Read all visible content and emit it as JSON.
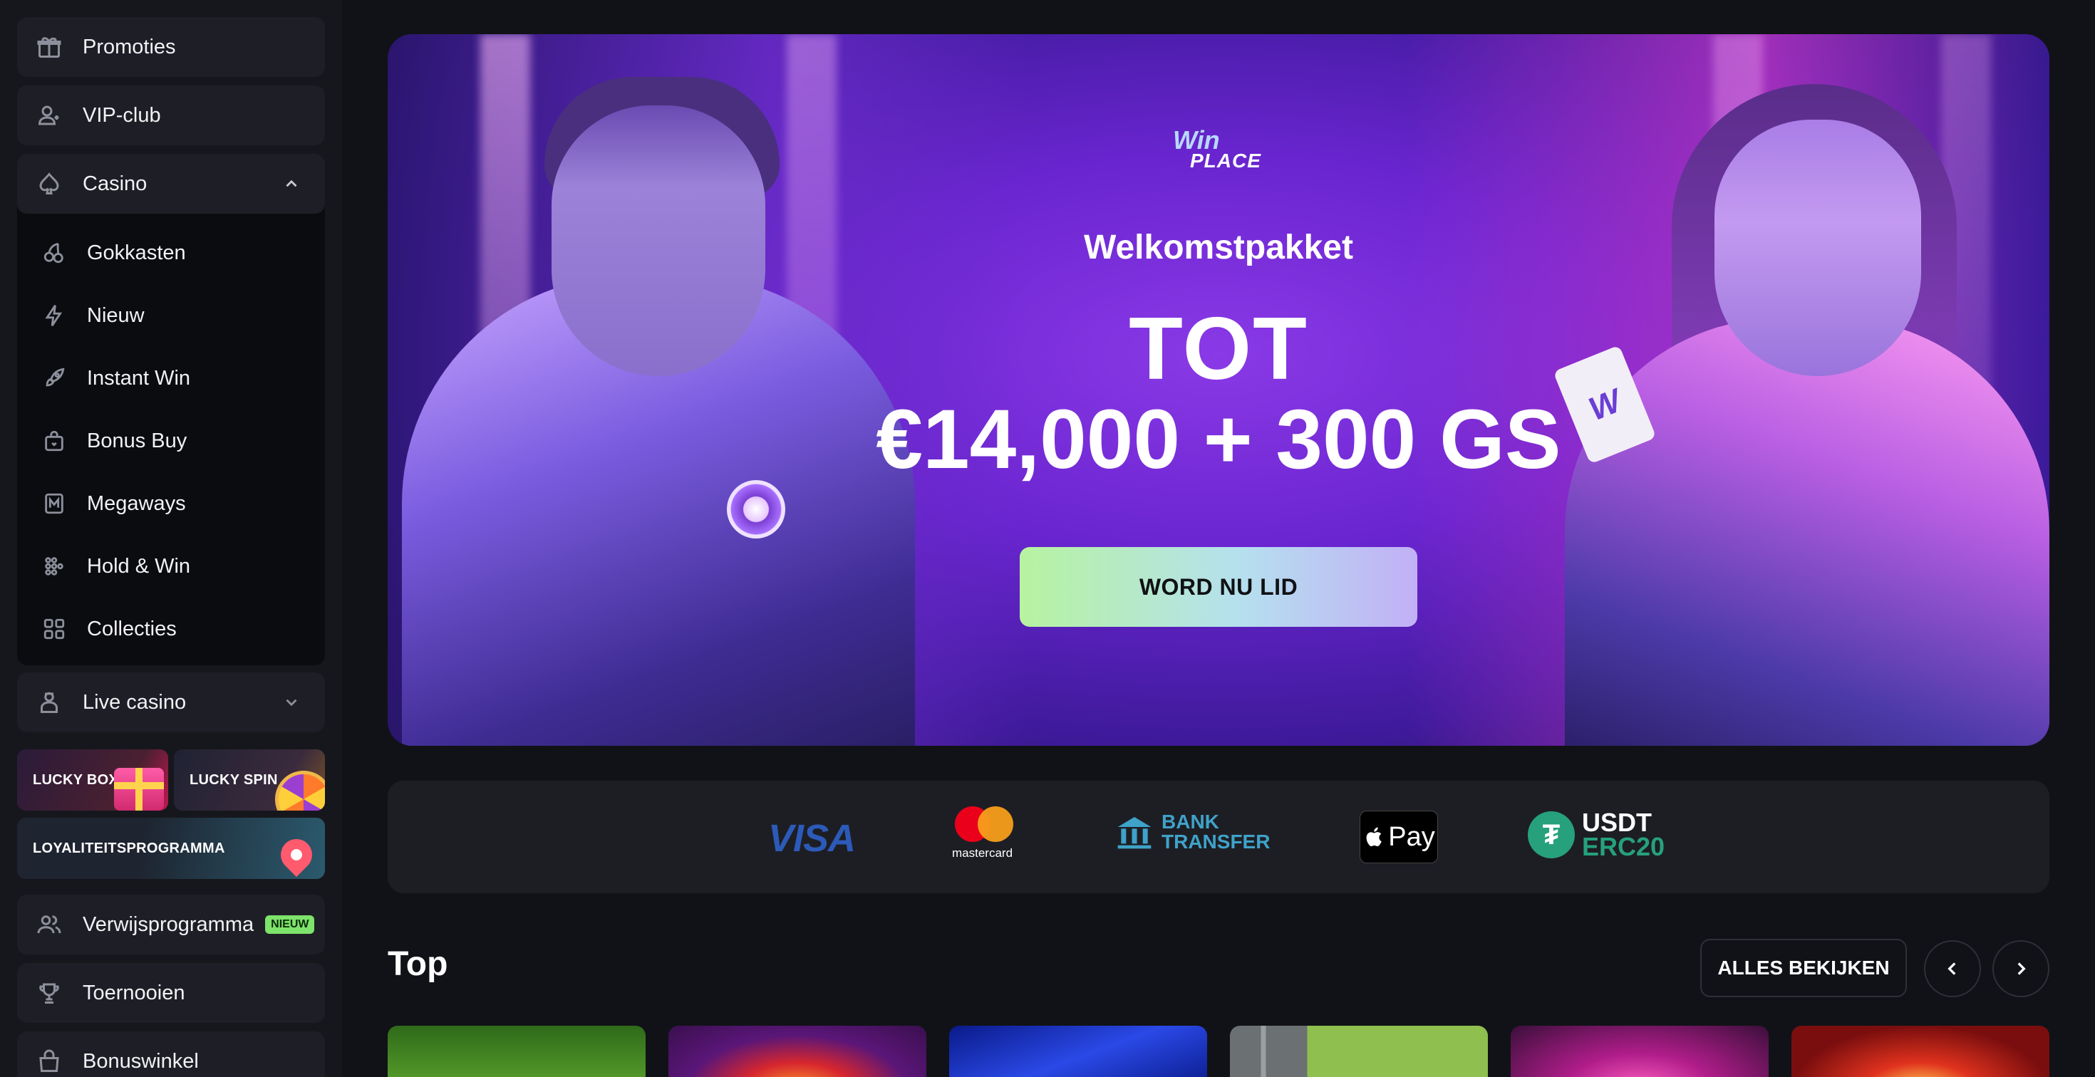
{
  "sidebar": {
    "promoties": "Promoties",
    "vip": "VIP-club",
    "casino": {
      "label": "Casino",
      "items": [
        {
          "label": "Gokkasten",
          "icon": "cherries-icon"
        },
        {
          "label": "Nieuw",
          "icon": "lightning-icon"
        },
        {
          "label": "Instant Win",
          "icon": "rocket-icon"
        },
        {
          "label": "Bonus Buy",
          "icon": "gift-bag-icon"
        },
        {
          "label": "Megaways",
          "icon": "megaways-icon"
        },
        {
          "label": "Hold & Win",
          "icon": "dots-grid-icon"
        },
        {
          "label": "Collecties",
          "icon": "grid-icon"
        }
      ]
    },
    "live_casino": "Live casino",
    "lucky_box": "LUCKY BOX",
    "lucky_spin": "LUCKY SPIN",
    "loyalty": "LOYALITEITSPROGRAMMA",
    "referral": "Verwijsprogramma",
    "referral_badge": "NIEUW",
    "tournaments": "Toernooien",
    "bonus_shop": "Bonuswinkel"
  },
  "hero": {
    "logo_top": "Win",
    "logo_bottom": "PLACE",
    "subtitle": "Welkomstpakket",
    "line1": "TOT",
    "line2": "€14,000 + 300 GS",
    "card_letter": "W",
    "cta": "WORD NU LID"
  },
  "payments": {
    "visa": "VISA",
    "mastercard": "mastercard",
    "bank_line1": "BANK",
    "bank_line2": "TRANSFER",
    "apple_pay": "Pay",
    "usdt_line1": "USDT",
    "usdt_line2": "ERC20"
  },
  "top": {
    "title": "Top",
    "view_all": "ALLES BEKIJKEN"
  },
  "colors": {
    "accent_green": "#7ee36b",
    "cta_start": "#b7f3a0",
    "cta_end": "#c2b0f6",
    "usdt": "#26a17b"
  }
}
